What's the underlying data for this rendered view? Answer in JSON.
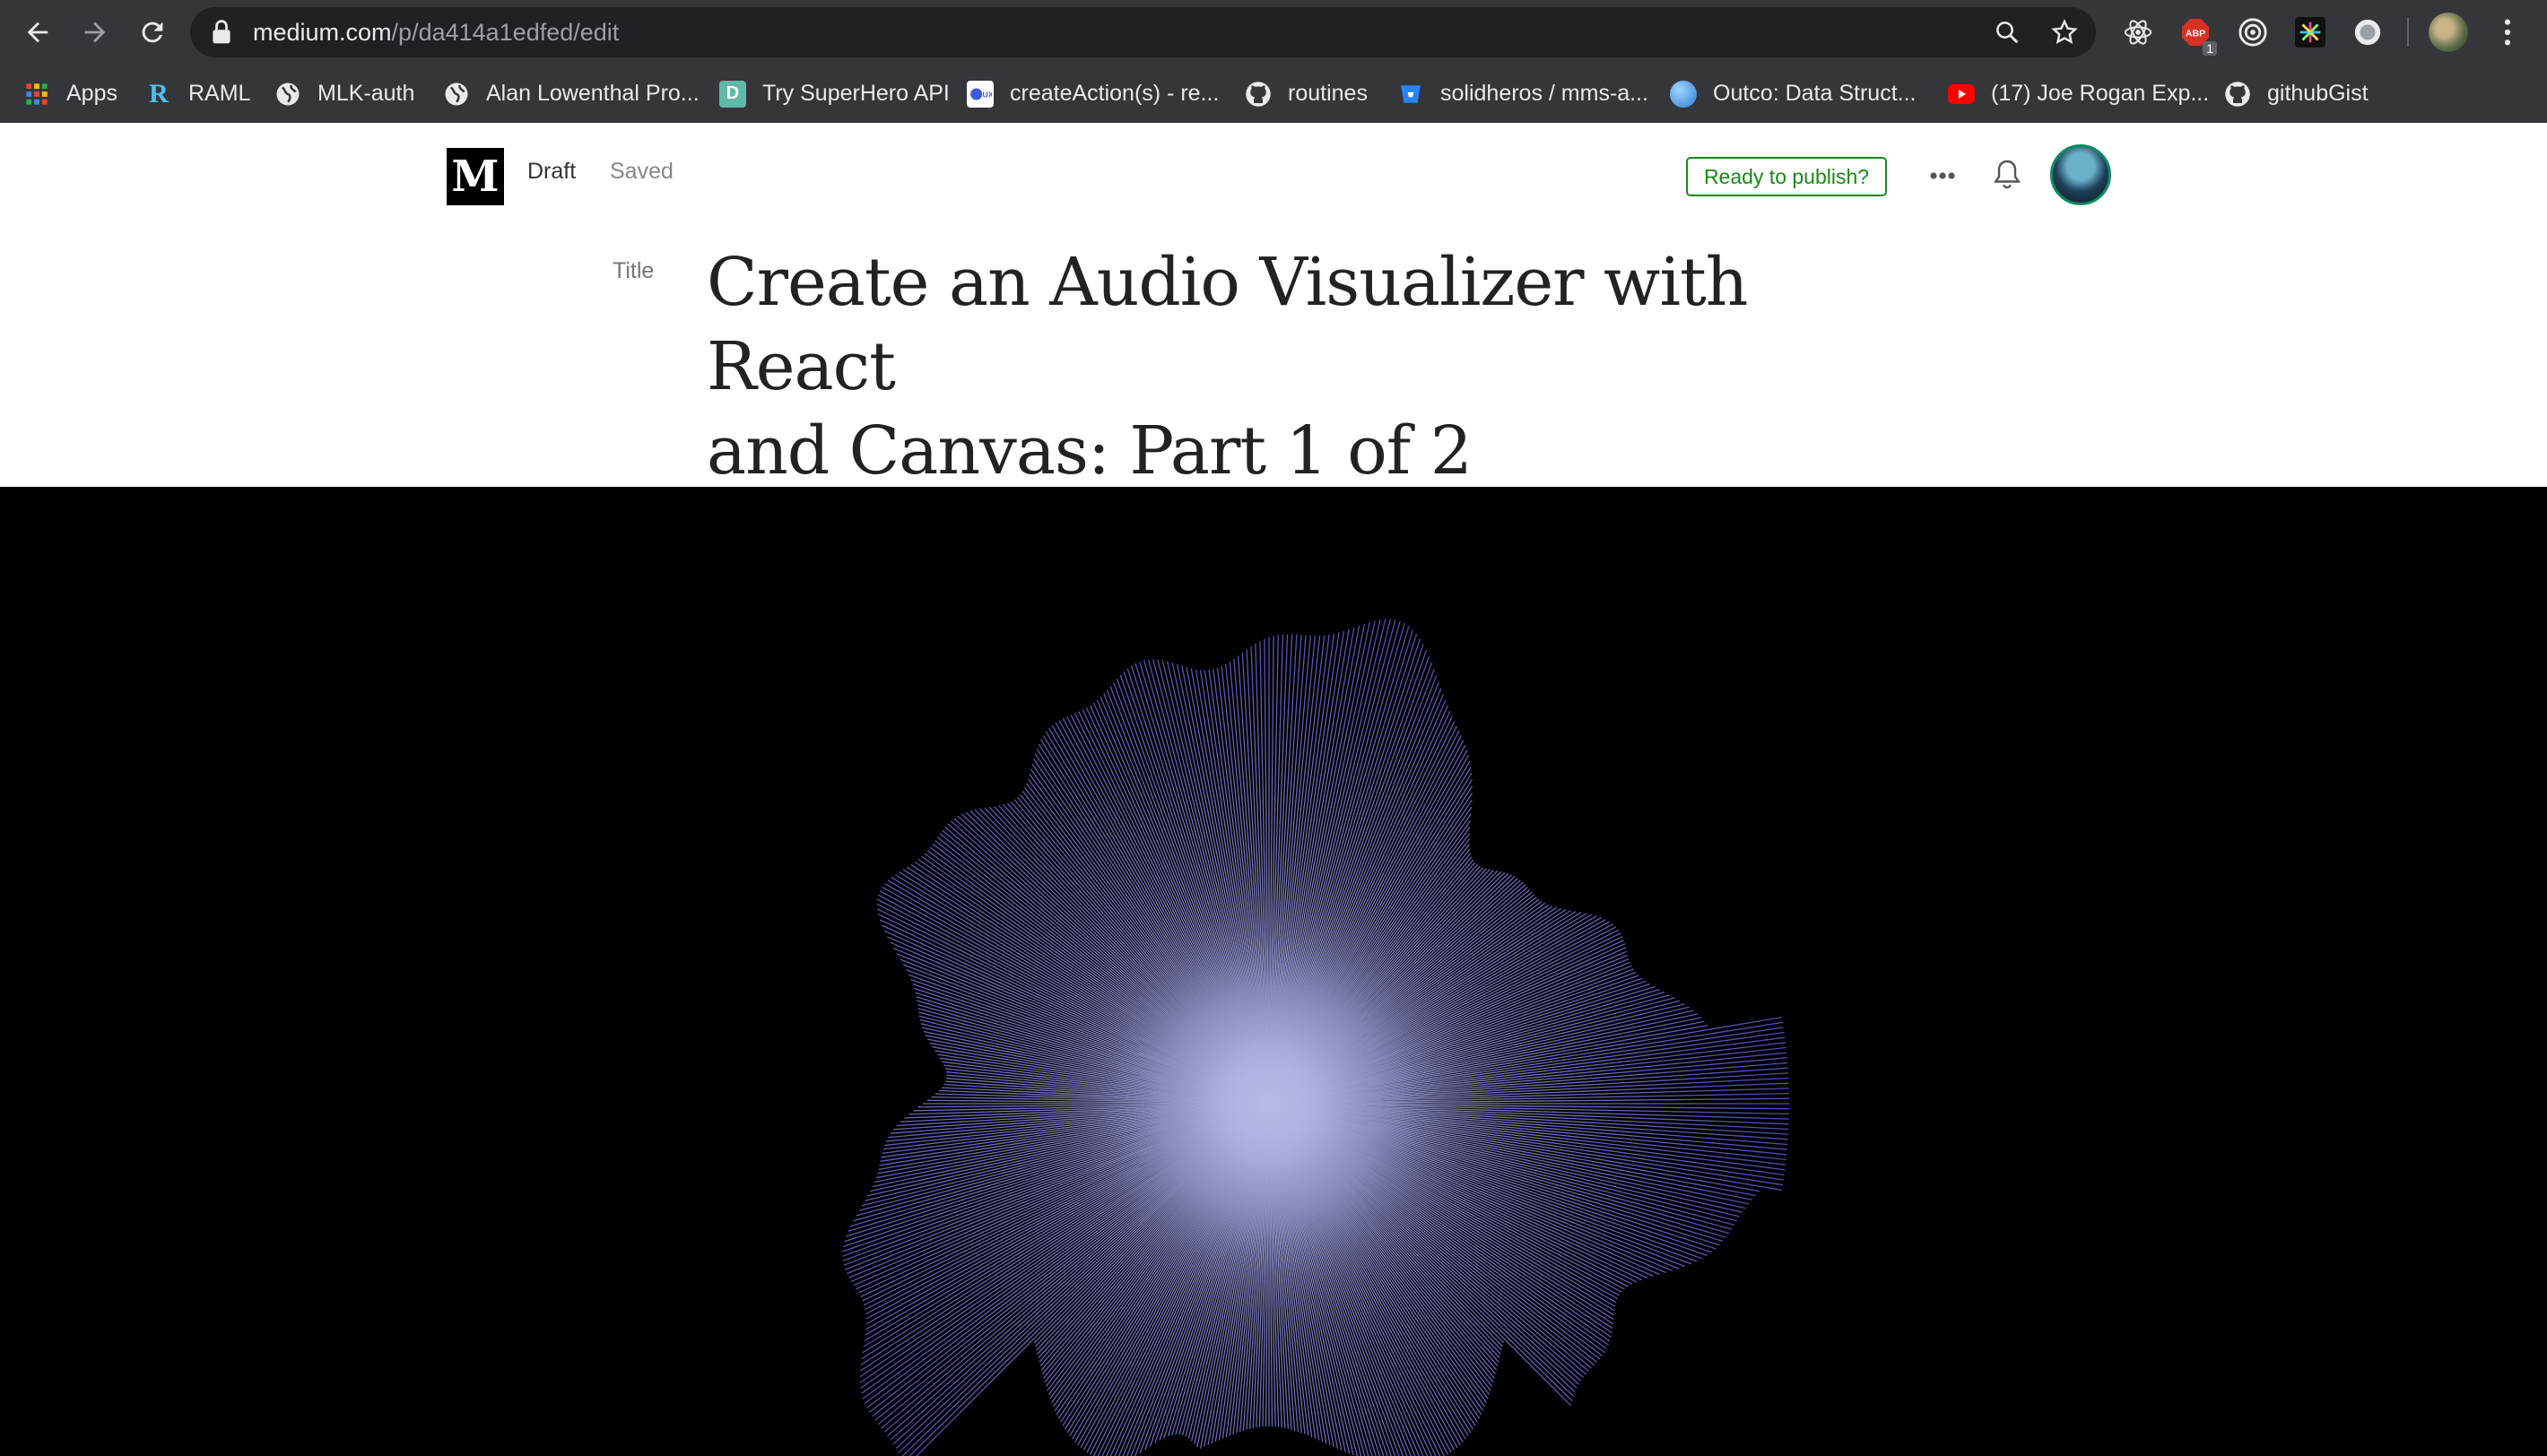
{
  "browser": {
    "url_host": "medium.com",
    "url_path": "/p/da414a1edfed/edit",
    "extensions": [
      "react-devtools-icon",
      "adblock-icon",
      "target-icon",
      "pinwheel-icon",
      "record-icon"
    ],
    "adblock_badge": "1",
    "bookmarks": [
      {
        "label": "Apps",
        "icon": "apps-grid-icon"
      },
      {
        "label": "RAML",
        "icon": "raml-icon"
      },
      {
        "label": "MLK-auth",
        "icon": "globe-icon"
      },
      {
        "label": "Alan Lowenthal Pro...",
        "icon": "globe-icon"
      },
      {
        "label": "Try SuperHero API",
        "icon": "d-icon"
      },
      {
        "label": "createAction(s) - re...",
        "icon": "duck-icon"
      },
      {
        "label": "routines",
        "icon": "github-icon"
      },
      {
        "label": "solidheros / mms-a...",
        "icon": "bitbucket-icon"
      },
      {
        "label": "Outco: Data Struct...",
        "icon": "outco-icon"
      },
      {
        "label": "(17) Joe Rogan Exp...",
        "icon": "youtube-icon"
      },
      {
        "label": "githubGist",
        "icon": "github-icon"
      }
    ]
  },
  "editor": {
    "logo": "M",
    "status_draft": "Draft",
    "status_saved": "Saved",
    "publish_label": "Ready to publish?",
    "more_label": "•••"
  },
  "article": {
    "title_label": "Title",
    "title_line1": "Create an Audio Visualizer with React",
    "title_line2": "and Canvas: Part 1 of 2"
  },
  "hero": {
    "colors": {
      "background": "#000000",
      "ray_inner": "#b9b9e6",
      "ray_outer": "#5a5ad0"
    }
  }
}
